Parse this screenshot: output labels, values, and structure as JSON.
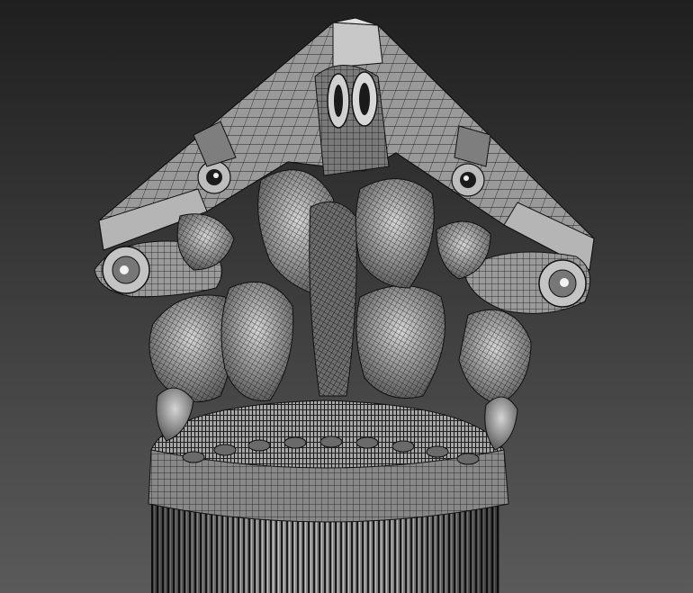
{
  "viewport": {
    "background_top_color": "#1f1f1f",
    "background_bottom_color": "#5a5a5a",
    "render_mode": "wireframe-shaded"
  },
  "model": {
    "subject": "corinthian-column-capital",
    "surface_color": "#9a9a9a",
    "highlight_color": "#d8d8d8",
    "shadow_color": "#3a3a3a",
    "wire_color": "#111111"
  }
}
